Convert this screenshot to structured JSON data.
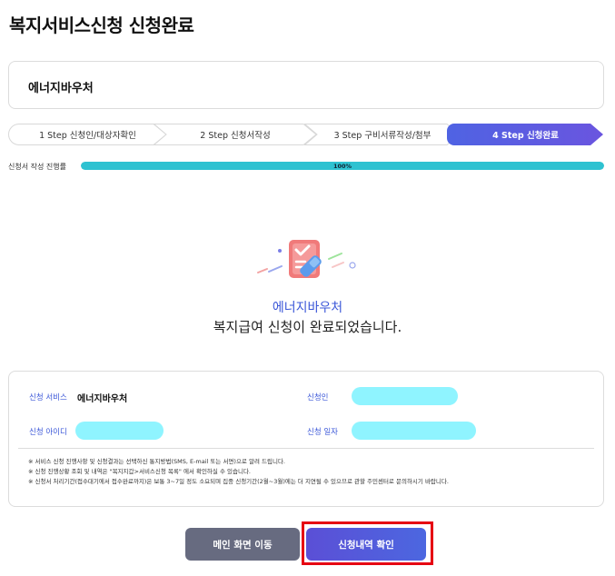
{
  "page": {
    "title": "복지서비스신청 신청완료",
    "service_name": "에너지바우처"
  },
  "steps": [
    {
      "label": "1 Step 신청인/대상자확인",
      "active": false
    },
    {
      "label": "2 Step 신청서작성",
      "active": false
    },
    {
      "label": "3 Step 구비서류작성/첨부",
      "active": false
    },
    {
      "label": "4 Step 신청완료",
      "active": true
    }
  ],
  "progress": {
    "label": "신청서 작성 진행률",
    "value": 100,
    "text": "100%"
  },
  "completion": {
    "service_name": "에너지바우처",
    "message": "복지급여 신청이 완료되었습니다."
  },
  "info": {
    "service_label": "신청 서비스",
    "service_value": "에너지바우처",
    "applicant_label": "신청인",
    "id_label": "신청 아이디",
    "date_label": "신청 일자",
    "notes": [
      "※ 서비스 신청 진행사항 및 신청결과는 선택하신 통지방법(SMS, E-mail 또는 서면)으로 알려 드립니다.",
      "※ 신청 진행상황 조회 및 내역은 \"복지지갑>서비스신청 목록\" 에서 확인하실 수 있습니다.",
      "※ 신청서 처리기간(접수대기에서 접수완료까지)은 보통 3~7일 정도 소요되며 집중 신청기간(2월~3월)에는 더 지연될 수 있으므로 관할 주민센터로 문의하시기 바랍니다."
    ]
  },
  "buttons": {
    "main": "메인 화면 이동",
    "history": "신청내역 확인"
  },
  "colors": {
    "accent": "#3b57d8",
    "step_active": "#5b5fe0",
    "progress_fill": "#2ec2d1",
    "masked_field": "#8ff4ff",
    "main_button": "#676b80",
    "highlight_border": "#e60012"
  }
}
